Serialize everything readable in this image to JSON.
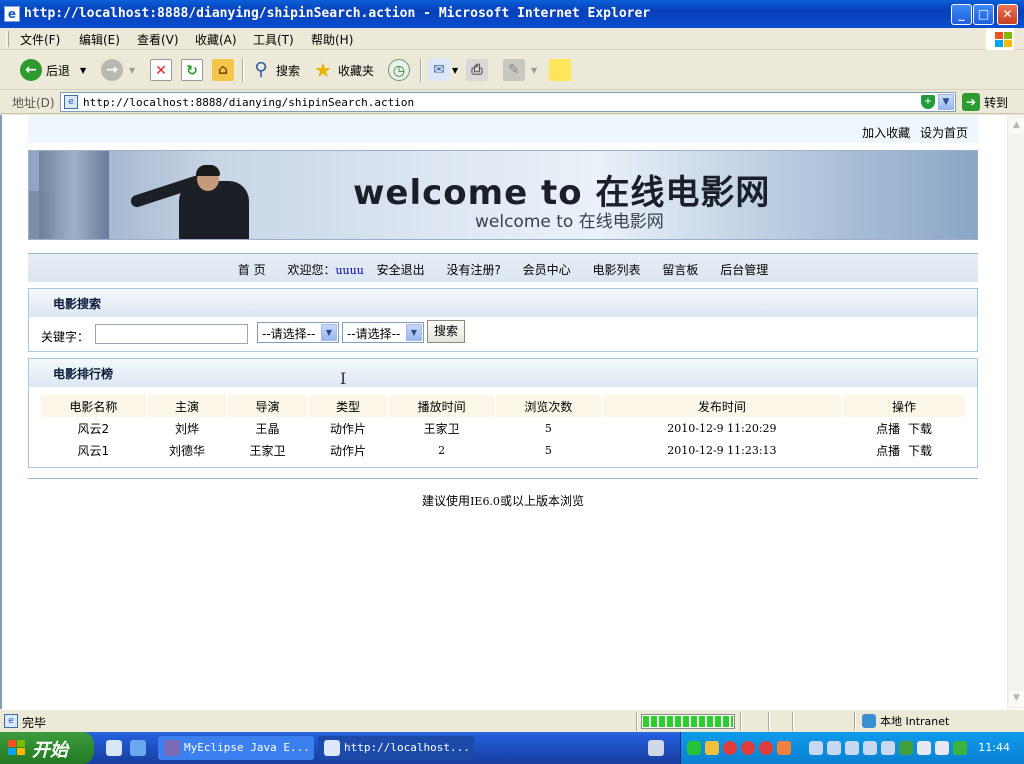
{
  "window": {
    "title": "http://localhost:8888/dianying/shipinSearch.action - Microsoft Internet Explorer",
    "min_glyph": "_",
    "max_glyph": "□",
    "close_glyph": "✕"
  },
  "menu": [
    "文件(F)",
    "编辑(E)",
    "查看(V)",
    "收藏(A)",
    "工具(T)",
    "帮助(H)"
  ],
  "toolbar": {
    "back_label": "后退",
    "search_label": "搜索",
    "favorites_label": "收藏夹"
  },
  "address": {
    "label": "地址(D)",
    "url": "http://localhost:8888/dianying/shipinSearch.action",
    "go_label": "转到"
  },
  "page": {
    "toplinks": [
      "加入收藏",
      "设为首页"
    ],
    "banner_title": "welcome to 在线电影网",
    "banner_subtitle": "welcome to 在线电影网",
    "nav": {
      "home": "首 页",
      "welcome": "欢迎您：",
      "username": "uuuu",
      "logout": "安全退出",
      "register": "没有注册?",
      "member": "会员中心",
      "movies": "电影列表",
      "guestbook": "留言板",
      "admin": "后台管理"
    },
    "search": {
      "heading": "电影搜索",
      "keyword_label": "关键字：",
      "keyword_value": "",
      "select1": "--请选择--",
      "select2": "--请选择--",
      "button": "搜索"
    },
    "ranking": {
      "heading": "电影排行榜",
      "columns": [
        "电影名称",
        "主演",
        "导演",
        "类型",
        "播放时间",
        "浏览次数",
        "发布时间",
        "操作"
      ],
      "rows": [
        {
          "name": "风云2",
          "star": "刘烨",
          "director": "王晶",
          "type": "动作片",
          "play_time": "王家卫",
          "views": "5",
          "published": "2010-12-9 11:20:29",
          "play": "点播",
          "download": "下载"
        },
        {
          "name": "风云1",
          "star": "刘德华",
          "director": "王家卫",
          "type": "动作片",
          "play_time": "2",
          "views": "5",
          "published": "2010-12-9 11:23:13",
          "play": "点播",
          "download": "下载"
        }
      ]
    },
    "footer_pre": "建议使用",
    "footer_ver": "IE6.0",
    "footer_post": "或以上版本浏览"
  },
  "status": {
    "text": "完毕",
    "progress": 1.0,
    "zone": "本地 Intranet"
  },
  "taskbar": {
    "start": "开始",
    "tasks": [
      "MyEclipse Java E...",
      "http://localhost..."
    ],
    "clock": "11:44"
  }
}
